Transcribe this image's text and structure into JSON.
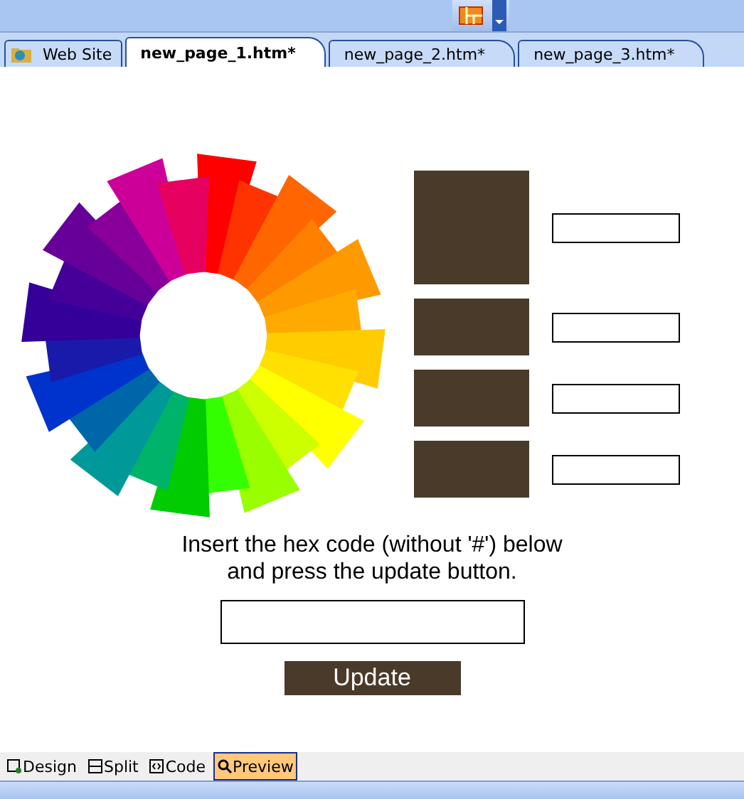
{
  "document_tabs": [
    {
      "label": "Web Site",
      "kind": "site",
      "selected": false
    },
    {
      "label": "new_page_1.htm*",
      "kind": "page",
      "selected": true
    },
    {
      "label": "new_page_2.htm*",
      "kind": "page",
      "selected": false
    },
    {
      "label": "new_page_3.htm*",
      "kind": "page",
      "selected": false
    }
  ],
  "page": {
    "swatches": [
      {
        "kind": "large"
      },
      {
        "kind": "small"
      },
      {
        "kind": "small"
      },
      {
        "kind": "small"
      }
    ],
    "instruction": [
      "Insert the hex code (without '#') below",
      "and press the update button."
    ],
    "update_button": "Update"
  },
  "view_tabs": [
    {
      "label": "Design",
      "selected": false
    },
    {
      "label": "Split",
      "selected": false
    },
    {
      "label": "Code",
      "selected": false
    },
    {
      "label": "Preview",
      "selected": true
    }
  ]
}
